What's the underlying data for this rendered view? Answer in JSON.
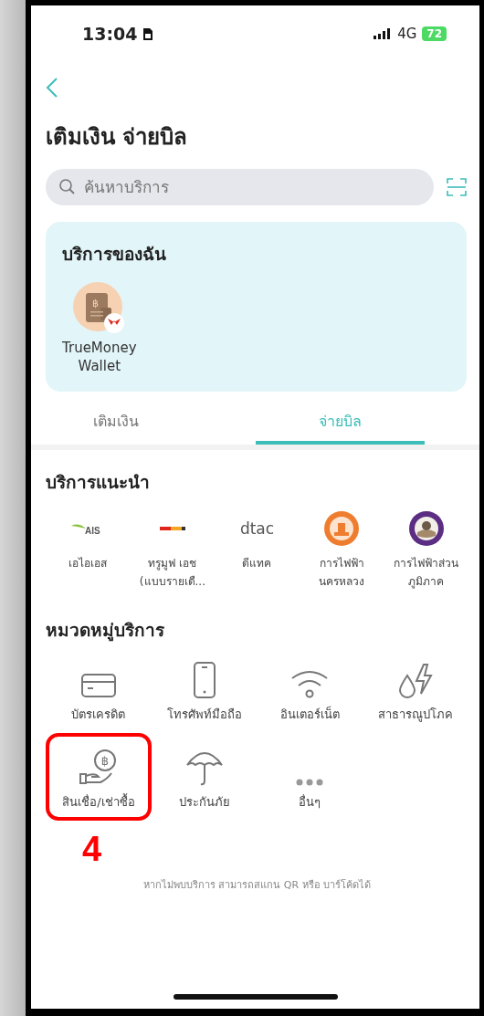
{
  "status_bar": {
    "time": "13:04",
    "network": "4G",
    "battery": "72"
  },
  "header": {
    "title": "เติมเงิน จ่ายบิล"
  },
  "search": {
    "placeholder": "ค้นหาบริการ"
  },
  "my_services": {
    "title": "บริการของฉัน",
    "items": [
      {
        "name": "TrueMoney\nWallet",
        "symbol": "฿"
      }
    ]
  },
  "tabs": [
    {
      "label": "เติมเงิน",
      "selected": false
    },
    {
      "label": "จ่ายบิล",
      "selected": true
    }
  ],
  "recommended": {
    "title": "บริการแนะนำ",
    "items": [
      {
        "kind": "ais",
        "logo_text": "AIS",
        "label": "เอไอเอส"
      },
      {
        "kind": "truemove",
        "label": "ทรูมูฟ เอช\n(แบบรายเดื..."
      },
      {
        "kind": "dtac",
        "logo_text": "dtac",
        "label": "ดีแทค"
      },
      {
        "kind": "mea",
        "label": "การไฟฟ้า\nนครหลวง"
      },
      {
        "kind": "pea",
        "label": "การไฟฟ้าส่วน\nภูมิภาค"
      }
    ]
  },
  "categories": {
    "title": "หมวดหมู่บริการ",
    "items": [
      {
        "kind": "card",
        "label": "บัตรเครดิต",
        "highlighted": false
      },
      {
        "kind": "phone",
        "label": "โทรศัพท์มือถือ",
        "highlighted": false
      },
      {
        "kind": "wifi",
        "label": "อินเตอร์เน็ต",
        "highlighted": false
      },
      {
        "kind": "utility",
        "label": "สาธารณูปโภค",
        "highlighted": false
      },
      {
        "kind": "loan",
        "label": "สินเชื่อ/เช่าซื้อ",
        "highlighted": true,
        "symbol": "฿"
      },
      {
        "kind": "umbrella",
        "label": "ประกันภัย",
        "highlighted": false
      },
      {
        "kind": "more",
        "label": "อื่นๆ",
        "highlighted": false
      }
    ]
  },
  "annotation": {
    "label": "4"
  },
  "footer": {
    "note": "หากไม่พบบริการ สามารถสแกน QR หรือ บาร์โค้ดได้"
  }
}
